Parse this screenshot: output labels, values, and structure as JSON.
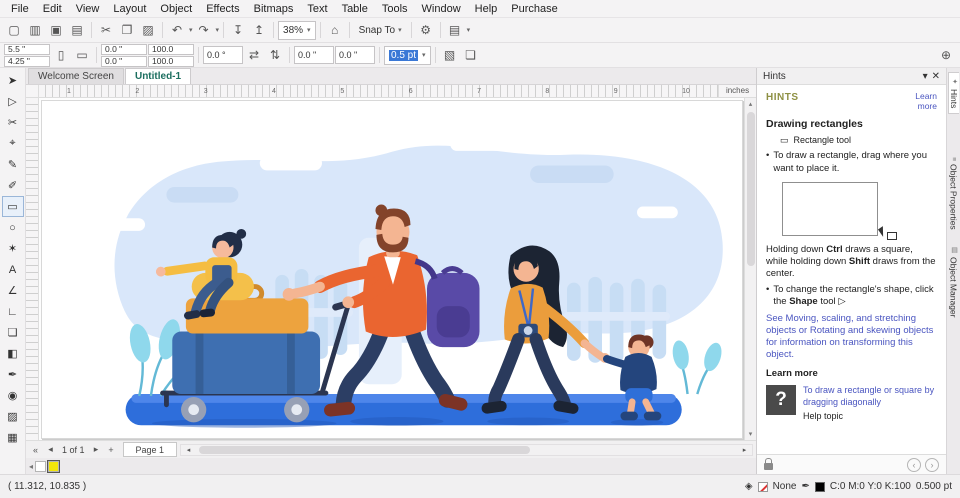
{
  "menubar": {
    "items": [
      "File",
      "Edit",
      "View",
      "Layout",
      "Object",
      "Effects",
      "Bitmaps",
      "Text",
      "Table",
      "Tools",
      "Window",
      "Help",
      "Purchase"
    ]
  },
  "toolbar": {
    "new_icon": "▢",
    "open_icon": "▥",
    "save_icon": "▣",
    "print_icon": "▤",
    "cut_icon": "✂",
    "copy_icon": "❐",
    "paste_icon": "▨",
    "undo_icon": "↶",
    "redo_icon": "↷",
    "import_icon": "↧",
    "export_icon": "↥",
    "zoom_value": "38%",
    "caret": "▾",
    "welcome_icon": "⌂",
    "snap_label": "Snap To",
    "options_icon": "⚙",
    "dockers_icon": "▤"
  },
  "propbar": {
    "page_width": "5.5 \"",
    "page_height": "4.25 \"",
    "portrait_icon": "▯",
    "landscape_icon": "▭",
    "pos_x": "0.0 \"",
    "pos_y": "0.0 \"",
    "scale_x": "100.0",
    "scale_y": "100.0",
    "angle": "0.0 °",
    "mirror_h": "⇄",
    "mirror_v": "⇅",
    "corner_a": "0.0 \"",
    "corner_b": "0.0 \"",
    "outline_width": "0.5 pt",
    "wrap_icon": "▧",
    "front_icon": "❏",
    "plus_icon": "⊕"
  },
  "tabs": {
    "welcome": "Welcome Screen",
    "untitled": "Untitled-1"
  },
  "toolbox": {
    "tools": [
      {
        "name": "pick-tool",
        "glyph": "➤"
      },
      {
        "name": "shape-tool",
        "glyph": "▷"
      },
      {
        "name": "crop-tool",
        "glyph": "✂"
      },
      {
        "name": "zoom-tool",
        "glyph": "⌖"
      },
      {
        "name": "freehand-tool",
        "glyph": "✎"
      },
      {
        "name": "artistic-media-tool",
        "glyph": "✐"
      },
      {
        "name": "rectangle-tool",
        "glyph": "▭"
      },
      {
        "name": "ellipse-tool",
        "glyph": "○"
      },
      {
        "name": "polygon-tool",
        "glyph": "✶"
      },
      {
        "name": "text-tool",
        "glyph": "A"
      },
      {
        "name": "dimension-tool",
        "glyph": "∠"
      },
      {
        "name": "connector-tool",
        "glyph": "∟"
      },
      {
        "name": "drop-shadow-tool",
        "glyph": "❏"
      },
      {
        "name": "transparency-tool",
        "glyph": "◧"
      },
      {
        "name": "color-eyedropper-tool",
        "glyph": "✒"
      },
      {
        "name": "interactive-fill-tool",
        "glyph": "◉"
      },
      {
        "name": "smart-fill-tool",
        "glyph": "▨"
      },
      {
        "name": "outline-pen-tool",
        "glyph": "▦"
      }
    ]
  },
  "ruler": {
    "numbers": [
      "1",
      "2",
      "3",
      "4",
      "5",
      "6",
      "7",
      "8",
      "9",
      "10"
    ],
    "unit": "inches"
  },
  "scroll": {
    "up": "▴",
    "down": "▾",
    "left": "◂",
    "right": "▸"
  },
  "pagenav": {
    "first": "«",
    "prev": "◂",
    "info": "1 of 1",
    "next": "▸",
    "add": "+",
    "tab": "Page 1"
  },
  "palette": {
    "scroll": "◂",
    "white": "#ffffff",
    "yellow": "#f2e50b"
  },
  "hints": {
    "title": "Hints",
    "flyout_icon": "▾",
    "close_icon": "✕",
    "header": "HINTS",
    "learn_more": "Learn more",
    "topic": "Drawing rectangles",
    "tool_icon": "▭",
    "tool_caption": "Rectangle tool",
    "bullet": "•",
    "b1": "To draw a rectangle, drag where you want to place it.",
    "p1a": "Holding down ",
    "p1b": "Ctrl",
    "p1c": " draws a square, while holding down ",
    "p1d": "Shift",
    "p1e": " draws from the center.",
    "b2a": "To change the rectangle's shape, click the ",
    "b2b": "Shape",
    "b2c": " tool",
    "b2_icon": "▷",
    "p2a": "See ",
    "p2b": "Moving, scaling, and stretching objects",
    "p2c": " or ",
    "p2d": "Rotating and skewing objects",
    "p2e": " for information on transforming this object.",
    "learn_more2": "Learn more",
    "qmark": "?",
    "help_link": "To draw a rectangle or square by dragging diagonally",
    "help_topic": "Help topic",
    "back_icon": "‹",
    "fwd_icon": "›"
  },
  "dockers": {
    "tabs": [
      {
        "icon": "✦",
        "label": "Hints"
      },
      {
        "icon": "≡",
        "label": "Object Properties"
      },
      {
        "icon": "▤",
        "label": "Object Manager"
      }
    ]
  },
  "statusbar": {
    "coords": "( 11.312, 10.835 )",
    "fill_icon": "◈",
    "fill_label": "None",
    "pen_icon": "✒",
    "outline_cmyk": "C:0 M:0 Y:0 K:100",
    "outline_pt": "0.500 pt"
  },
  "illustration": {
    "bg_blob": "#d9e7fa",
    "ground": "#2e6edb",
    "father_jacket": "#ea6530",
    "backpack": "#594aa7",
    "skin": "#f4b592",
    "father_hair": "#83432a",
    "dark_hair": "#1c2433",
    "mother_top": "#eb9d3c",
    "girl_shirt": "#f5bd42",
    "overalls": "#3c5c8e",
    "boy_hoodie": "#24457d",
    "boy_shorts": "#2f6fd8",
    "leaves": "#8fd8ec",
    "suitcase_blue": "#3e6fb1",
    "suitcase_orange": "#eda33e",
    "pants": "#2c3e64",
    "shoes": "#7c3326"
  }
}
